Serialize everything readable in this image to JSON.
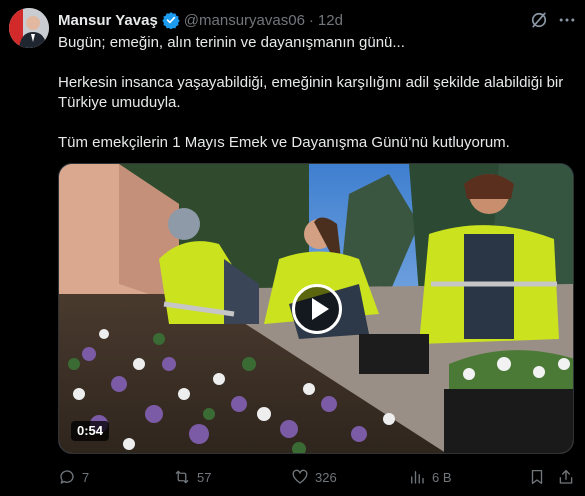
{
  "tweet": {
    "author_name": "Mansur Yavaş",
    "handle": "@mansuryavas06",
    "separator": "·",
    "time": "12d",
    "text_lines": [
      "Bugün; emeğin, alın terinin ve dayanışmanın günü...",
      "Herkesin insanca yaşayabildiği, emeğinin karşılığını adil şekilde alabildiği bir",
      "Türkiye umuduyla.",
      "Tüm emekçilerin 1 Mayıs Emek ve Dayanışma Günü’nü kutluyorum."
    ]
  },
  "media": {
    "duration": "0:54"
  },
  "actions": {
    "replies": "7",
    "reposts": "57",
    "likes": "326",
    "views": "6 B"
  },
  "colors": {
    "background": "#000000",
    "text": "#e7e9ea",
    "muted": "#71767b",
    "verified": "#1d9bf0"
  },
  "icons": [
    "verified-badge-icon",
    "grok-icon",
    "more-icon",
    "reply-icon",
    "repost-icon",
    "like-icon",
    "views-icon",
    "bookmark-icon",
    "share-icon",
    "play-icon"
  ]
}
